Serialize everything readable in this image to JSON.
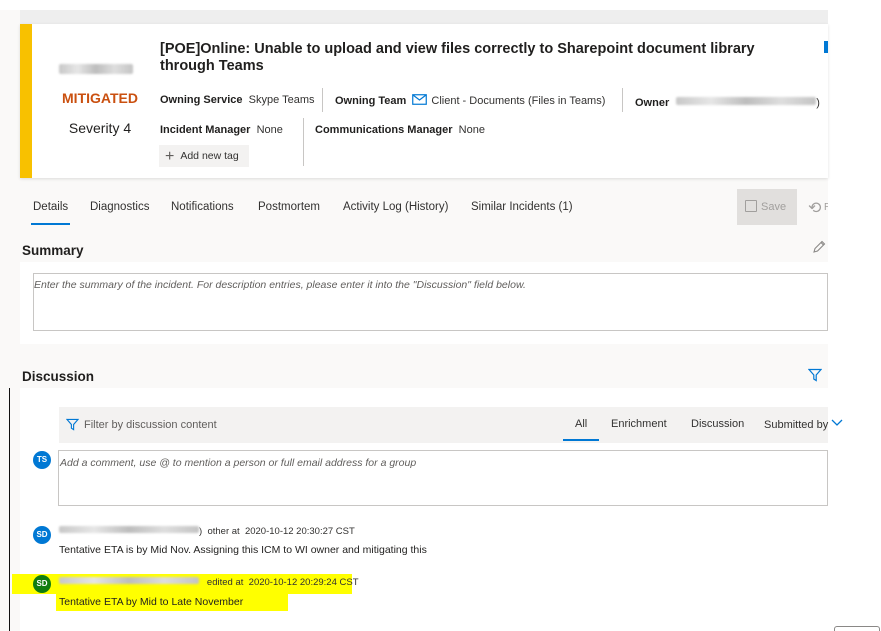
{
  "incident": {
    "title": "[POE]Online: Unable to upload and view files correctly to Sharepoint document library through Teams",
    "status": "MITIGATED",
    "severity": "Severity 4",
    "owning_service_label": "Owning Service",
    "owning_service_value": "Skype Teams",
    "owning_team_label": "Owning Team",
    "owning_team_value": "Client - Documents (Files in Teams)",
    "owner_label": "Owner",
    "owner_suffix": ")",
    "incident_manager_label": "Incident Manager",
    "incident_manager_value": "None",
    "communications_manager_label": "Communications Manager",
    "communications_manager_value": "None",
    "add_tag_label": "Add new tag"
  },
  "tabs": [
    {
      "label": "Details"
    },
    {
      "label": "Diagnostics"
    },
    {
      "label": "Notifications"
    },
    {
      "label": "Postmortem"
    },
    {
      "label": "Activity Log (History)"
    },
    {
      "label": "Similar Incidents (1)"
    }
  ],
  "toolbar": {
    "save_label": "Save",
    "undo_fragment": "R"
  },
  "summary": {
    "title": "Summary",
    "placeholder": "Enter the summary of the incident. For description entries, please enter it into the \"Discussion\" field below."
  },
  "discussion": {
    "title": "Discussion",
    "filter_placeholder": "Filter by discussion content",
    "filter_tabs": [
      "All",
      "Enrichment",
      "Discussion"
    ],
    "submitted_by_label": "Submitted by",
    "comment_placeholder": "Add a comment, use @ to mention a person or full email address for a group",
    "current_user_initials": "TS",
    "entries": [
      {
        "initials": "SD",
        "name_suffix": ")",
        "action": "other at",
        "timestamp": "2020-10-12 20:30:27 CST",
        "text": "Tentative ETA is by Mid Nov. Assigning this ICM to WI owner and mitigating this"
      },
      {
        "initials": "SD",
        "action": "edited at",
        "timestamp": "2020-10-12 20:29:24 CST",
        "text": "Tentative ETA by Mid to Late November"
      }
    ]
  },
  "colors": {
    "accent_bar": "#f8c100",
    "status_orange": "#ca5010",
    "primary_blue": "#0078d4",
    "highlight_yellow": "#ffff00"
  },
  "icons": [
    "mail-icon",
    "plus-icon",
    "save-icon",
    "undo-icon",
    "edit-pencil-icon",
    "filter-icon",
    "chevron-down-icon"
  ]
}
